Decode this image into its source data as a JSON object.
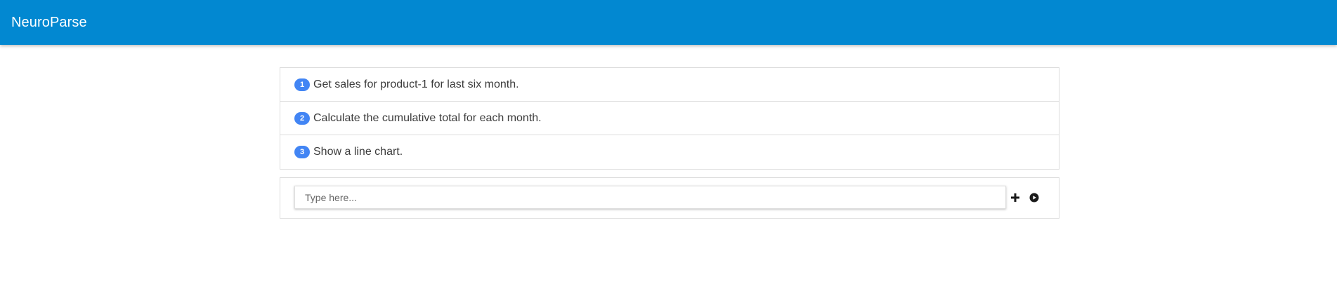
{
  "app": {
    "title": "NeuroParse",
    "accent_color": "#0288d1"
  },
  "steps": [
    {
      "number": "1",
      "text": "Get sales for product-1 for last six month."
    },
    {
      "number": "2",
      "text": "Calculate the cumulative total for each month."
    },
    {
      "number": "3",
      "text": "Show a line chart."
    }
  ],
  "composer": {
    "placeholder": "Type here...",
    "value": "",
    "add_icon": "plus-icon",
    "run_icon": "play-circle-icon"
  }
}
